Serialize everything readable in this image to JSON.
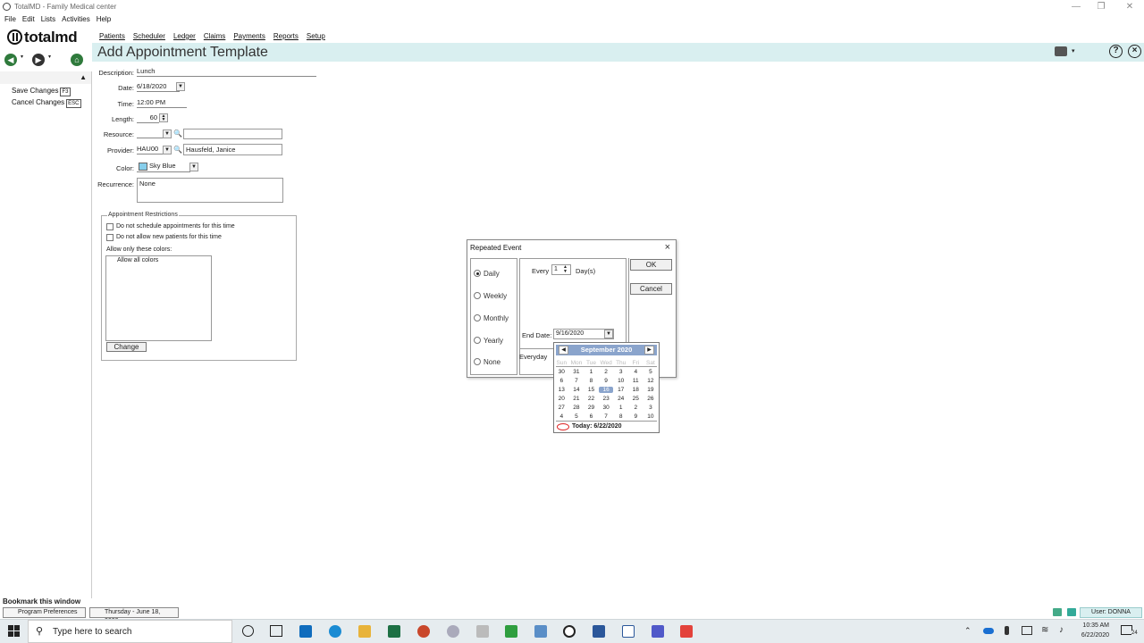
{
  "window": {
    "title": "TotalMD - Family Medical center"
  },
  "menu": {
    "items": [
      "File",
      "Edit",
      "Lists",
      "Activities",
      "Help"
    ]
  },
  "logo": {
    "text": "totalmd"
  },
  "topnav": {
    "items": [
      "Patients",
      "Scheduler",
      "Ledger",
      "Claims",
      "Payments",
      "Reports",
      "Setup"
    ]
  },
  "page": {
    "title": "Add Appointment Template"
  },
  "sidebar": {
    "save_label": "Save Changes",
    "save_key": "F3",
    "cancel_label": "Cancel Changes",
    "cancel_key": "ESC",
    "bookmark": "Bookmark this window"
  },
  "form": {
    "description_label": "Description:",
    "description_value": "Lunch",
    "date_label": "Date:",
    "date_value": "6/18/2020",
    "time_label": "Time:",
    "time_value": "12:00 PM",
    "length_label": "Length:",
    "length_value": "60",
    "resource_label": "Resource:",
    "resource_value": "",
    "provider_label": "Provider:",
    "provider_code": "HAU00",
    "provider_name": "Hausfeld, Janice",
    "color_label": "Color:",
    "color_value": "Sky Blue",
    "color_swatch": "#87ceeb",
    "recurrence_label": "Recurrence:",
    "recurrence_value": "None"
  },
  "restrictions": {
    "legend": "Appointment Restrictions",
    "no_schedule": "Do not schedule appointments for this time",
    "no_new_patients": "Do not allow new patients for this time",
    "colors_label": "Allow only these colors:",
    "colors_value": "Allow all colors",
    "change_button": "Change"
  },
  "dialog": {
    "title": "Repeated Event",
    "options": [
      "Daily",
      "Weekly",
      "Monthly",
      "Yearly",
      "None"
    ],
    "selected": "Daily",
    "every_label": "Every",
    "every_value": "1",
    "unit_label": "Day(s)",
    "end_date_label": "End Date:",
    "end_date_value": "9/16/2020",
    "summary": "Everyday",
    "ok_button": "OK",
    "cancel_button": "Cancel"
  },
  "calendar": {
    "month": "September 2020",
    "dow": [
      "Sun",
      "Mon",
      "Tue",
      "Wed",
      "Thu",
      "Fri",
      "Sat"
    ],
    "weeks": [
      [
        "30",
        "31",
        "1",
        "2",
        "3",
        "4",
        "5"
      ],
      [
        "6",
        "7",
        "8",
        "9",
        "10",
        "11",
        "12"
      ],
      [
        "13",
        "14",
        "15",
        "16",
        "17",
        "18",
        "19"
      ],
      [
        "20",
        "21",
        "22",
        "23",
        "24",
        "25",
        "26"
      ],
      [
        "27",
        "28",
        "29",
        "30",
        "1",
        "2",
        "3"
      ],
      [
        "4",
        "5",
        "6",
        "7",
        "8",
        "9",
        "10"
      ]
    ],
    "selected_day": "16",
    "today_label": "Today: 6/22/2020",
    "header_color": "#8aa4cc"
  },
  "status": {
    "tab1": "Program Preferences",
    "tab2": "Thursday - June 18, 2020",
    "user": "User: DONNA"
  },
  "taskbar": {
    "search_placeholder": "Type here to search",
    "time": "10:35 AM",
    "date": "6/22/2020",
    "notifications": "24"
  },
  "colors": {
    "accent": "#d9eff0",
    "nav_green": "#2f7a3c"
  }
}
